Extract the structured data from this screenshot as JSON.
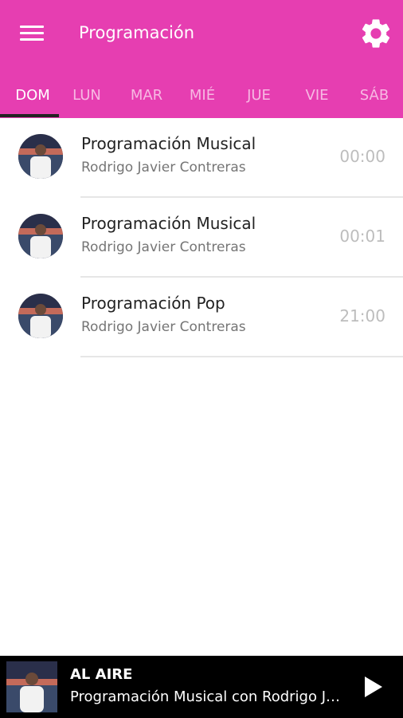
{
  "app_bar": {
    "title": "Programación",
    "background": "#e63eb1"
  },
  "tabs": [
    {
      "label": "DOM",
      "active": true
    },
    {
      "label": "LUN",
      "active": false
    },
    {
      "label": "MAR",
      "active": false
    },
    {
      "label": "MIÉ",
      "active": false
    },
    {
      "label": "JUE",
      "active": false
    },
    {
      "label": "VIE",
      "active": false
    },
    {
      "label": "SÁB",
      "active": false
    }
  ],
  "schedule": [
    {
      "title": "Programación Musical",
      "host": "Rodrigo Javier Contreras",
      "time": "00:00"
    },
    {
      "title": "Programación Musical",
      "host": "Rodrigo Javier Contreras",
      "time": "00:01"
    },
    {
      "title": "Programación Pop",
      "host": "Rodrigo Javier Contreras",
      "time": "21:00"
    }
  ],
  "player": {
    "label": "AL AIRE",
    "track": "Programación Musical con Rodrigo Javier Contreras"
  },
  "icons": {
    "menu": "menu-icon",
    "settings": "gear-icon",
    "play": "play-icon"
  }
}
